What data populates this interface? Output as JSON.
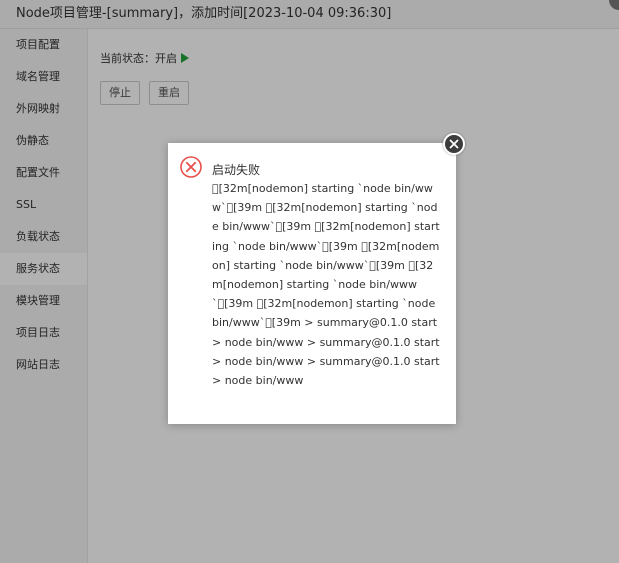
{
  "window": {
    "title": "Node项目管理-[summary]，添加时间[2023-10-04 09:36:30]"
  },
  "sidebar": {
    "items": [
      {
        "label": "项目配置"
      },
      {
        "label": "域名管理"
      },
      {
        "label": "外网映射"
      },
      {
        "label": "伪静态"
      },
      {
        "label": "配置文件"
      },
      {
        "label": "SSL"
      },
      {
        "label": "负载状态"
      },
      {
        "label": "服务状态"
      },
      {
        "label": "模块管理"
      },
      {
        "label": "项目日志"
      },
      {
        "label": "网站日志"
      }
    ],
    "active_index": 7
  },
  "main": {
    "status_label": "当前状态：",
    "status_value": "开启",
    "status_icon": "play-icon",
    "stop_label": "停止",
    "restart_label": "重启"
  },
  "dialog": {
    "icon": "error-icon",
    "title": "启动失败",
    "message": "\u0000[32m[nodemon] starting `node bin/www`\u0000[39m \u0000[32m[nodemon] starting `node bin/www`\u0000[39m \u0000[32m[nodemon] starting `node bin/www`\u0000[39m \u0000[32m[nodemon] starting `node bin/www`\u0000[39m \u0000[32m[nodemon] starting `node bin/www`\u0000[39m \u0000[32m[nodemon] starting `node bin/www`\u0000[39m > summary@0.1.0 start > node bin/www > summary@0.1.0 start > node bin/www > summary@0.1.0 start > node bin/www",
    "close_icon": "close-icon"
  },
  "colors": {
    "accent_green": "#20a53a",
    "error_red": "#e8504d",
    "overlay": "rgba(0,0,0,0.30)"
  }
}
